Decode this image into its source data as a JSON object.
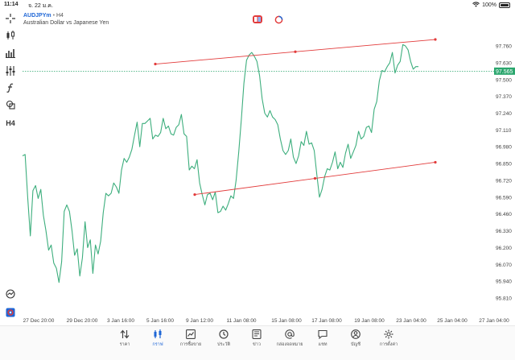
{
  "status": {
    "time": "11:14",
    "date": "จ. 22 ม.ค.",
    "battery": "100%"
  },
  "symbol": {
    "ticker": "AUDJPYm",
    "sep": "•",
    "timeframe": "H4",
    "description": "Australian Dollar vs Japanese Yen"
  },
  "toolbar": {
    "items": [
      "crosshair-icon",
      "candles-icon",
      "chart-type-icon",
      "indicators-icon",
      "function-icon",
      "objects-icon"
    ],
    "timeframe_label": "H4"
  },
  "colors": {
    "line": "#3dae7d",
    "trend": "#e23b3b",
    "price_label_bg": "#2aa66d",
    "active": "#1e66d6"
  },
  "chart_data": {
    "type": "line",
    "series": [
      {
        "values": [
          96.91,
          96.92,
          96.58,
          96.29,
          96.64,
          96.68,
          96.58,
          96.65,
          96.45,
          96.33,
          96.18,
          96.22,
          96.08,
          96.04,
          95.93,
          96.09,
          96.48,
          96.53,
          96.48,
          96.33,
          96.14,
          96.19,
          95.98,
          96.12,
          96.4,
          96.2,
          96.26,
          96.0,
          96.22,
          96.15,
          96.25,
          96.47,
          96.62,
          96.6,
          96.62,
          96.7,
          96.67,
          96.62,
          96.8,
          96.89,
          96.86,
          96.9,
          96.96,
          97.07,
          97.17,
          96.98,
          97.16,
          97.16,
          97.18,
          97.2,
          97.04,
          97.07,
          97.06,
          97.09,
          97.2,
          97.12,
          97.14,
          97.08,
          97.07,
          97.13,
          97.15,
          97.23,
          97.08,
          97.06,
          96.8,
          96.83,
          96.81,
          96.88,
          96.7,
          96.61,
          96.53,
          96.61,
          96.62,
          96.57,
          96.63,
          96.47,
          96.48,
          96.52,
          96.49,
          96.54,
          96.6,
          96.58,
          96.72,
          96.94,
          97.19,
          97.47,
          97.65,
          97.69,
          97.71,
          97.68,
          97.64,
          97.53,
          97.35,
          97.24,
          97.21,
          97.26,
          97.21,
          97.19,
          97.15,
          97.04,
          96.95,
          96.92,
          96.95,
          97.04,
          96.9,
          96.85,
          96.91,
          97.02,
          96.99,
          97.1,
          97.0,
          97.01,
          96.95,
          96.76,
          96.59,
          96.65,
          96.75,
          96.81,
          96.8,
          96.86,
          96.94,
          96.81,
          96.86,
          96.82,
          96.93,
          97.0,
          96.89,
          96.94,
          96.99,
          97.1,
          97.04,
          97.06,
          97.13,
          97.14,
          97.09,
          97.27,
          97.33,
          97.49,
          97.57,
          97.56,
          97.6,
          97.63,
          97.71,
          97.55,
          97.61,
          97.64,
          97.77,
          97.76,
          97.73,
          97.64,
          97.58,
          97.6,
          97.6
        ]
      }
    ],
    "trendlines": [
      {
        "from": {
          "x": "5 Jan 16:00",
          "y": 97.62
        },
        "to": {
          "x": "25 Jan 04:00",
          "y": 97.81
        }
      },
      {
        "from": {
          "x": "9 Jan 12:00",
          "y": 96.61
        },
        "to": {
          "x": "25 Jan 04:00",
          "y": 96.86
        }
      }
    ],
    "current_price": "97.565",
    "yticks": [
      "97.760",
      "97.630",
      "97.500",
      "97.370",
      "97.240",
      "97.110",
      "96.980",
      "96.850",
      "96.720",
      "96.590",
      "96.460",
      "96.330",
      "96.200",
      "96.070",
      "95.940",
      "95.810"
    ],
    "xticks": [
      "27 Dec 20:00",
      "29 Dec 20:00",
      "3 Jan 16:00",
      "5 Jan 16:00",
      "9 Jan 12:00",
      "11 Jan 08:00",
      "15 Jan 08:00",
      "17 Jan 08:00",
      "19 Jan 08:00",
      "23 Jan 04:00",
      "25 Jan 04:00",
      "27 Jan 04:00"
    ],
    "ylim": [
      95.76,
      97.86
    ],
    "grid": false
  },
  "nav": [
    {
      "label": "ราคา",
      "icon": "arrows-icon"
    },
    {
      "label": "กราฟ",
      "icon": "candles-icon"
    },
    {
      "label": "การซื้อขาย",
      "icon": "trade-icon"
    },
    {
      "label": "ประวัติ",
      "icon": "history-icon"
    },
    {
      "label": "ข่าว",
      "icon": "news-icon"
    },
    {
      "label": "กล่องจดหมาย",
      "icon": "mail-icon"
    },
    {
      "label": "แชท",
      "icon": "chat-icon"
    },
    {
      "label": "บัญชี",
      "icon": "account-icon"
    },
    {
      "label": "การตั้งค่า",
      "icon": "settings-icon"
    }
  ]
}
